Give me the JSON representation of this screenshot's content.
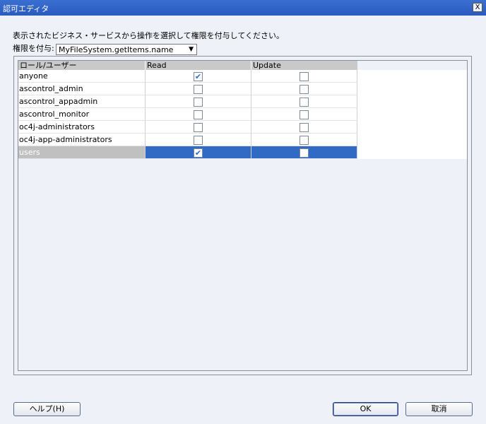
{
  "window": {
    "title": "認可エディタ",
    "close_label": "X"
  },
  "instruction": "表示されたビジネス・サービスから操作を選択して権限を付与してください。",
  "grant": {
    "label": "権限を付与:",
    "selected": "MyFileSystem.getItems.name"
  },
  "table": {
    "headers": [
      "ロール/ユーザー",
      "Read",
      "Update"
    ],
    "rows": [
      {
        "name": "anyone",
        "read": true,
        "update": false
      },
      {
        "name": "ascontrol_admin",
        "read": false,
        "update": false
      },
      {
        "name": "ascontrol_appadmin",
        "read": false,
        "update": false
      },
      {
        "name": "ascontrol_monitor",
        "read": false,
        "update": false
      },
      {
        "name": "oc4j-administrators",
        "read": false,
        "update": false
      },
      {
        "name": "oc4j-app-administrators",
        "read": false,
        "update": false
      },
      {
        "name": "users",
        "read": true,
        "update": false,
        "selected": true
      }
    ]
  },
  "buttons": {
    "help": "ヘルプ(H)",
    "ok": "OK",
    "cancel": "取消"
  },
  "icons": {
    "check": "✔",
    "dropdown": "▼"
  }
}
